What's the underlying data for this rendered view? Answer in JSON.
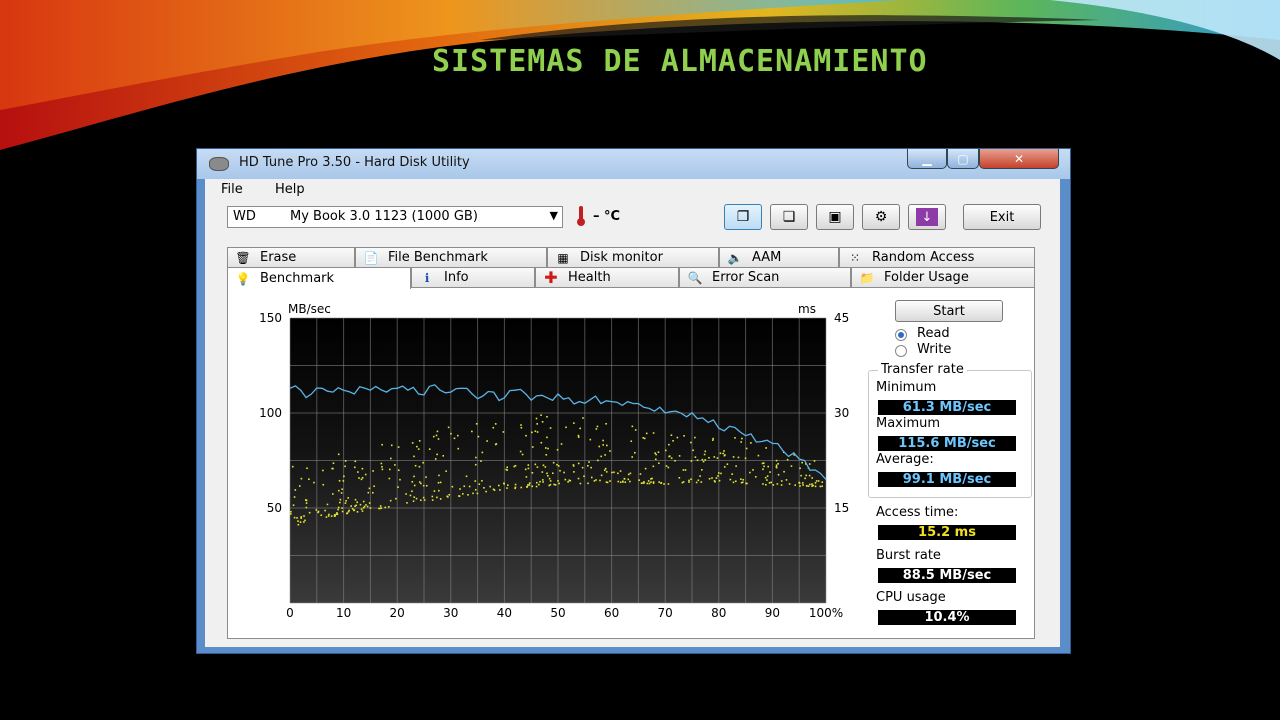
{
  "slide": {
    "title": "SISTEMAS DE ALMACENAMIENTO",
    "title_color": "#8fd14f"
  },
  "window": {
    "title": "HD Tune Pro 3.50 - Hard Disk Utility",
    "icon": "hard-disk-icon"
  },
  "menu": {
    "file": "File",
    "help": "Help"
  },
  "toolbar": {
    "drive_brand": "WD",
    "drive_model": "My Book 3.0 1123 (1000 GB)",
    "temperature": "– °C",
    "exit_label": "Exit",
    "icons": [
      "copy-text-icon",
      "copy-screenshot-icon",
      "save-icon",
      "options-icon",
      "download-icon"
    ]
  },
  "tabs": {
    "row1": [
      {
        "label": "Erase",
        "icon": "trash-icon"
      },
      {
        "label": "File Benchmark",
        "icon": "file-benchmark-icon"
      },
      {
        "label": "Disk monitor",
        "icon": "disk-monitor-icon"
      },
      {
        "label": "AAM",
        "icon": "speaker-icon"
      },
      {
        "label": "Random Access",
        "icon": "random-access-icon"
      }
    ],
    "row2": [
      {
        "label": "Benchmark",
        "icon": "lightbulb-icon",
        "selected": true
      },
      {
        "label": "Info",
        "icon": "info-icon"
      },
      {
        "label": "Health",
        "icon": "health-cross-icon"
      },
      {
        "label": "Error Scan",
        "icon": "magnifier-icon"
      },
      {
        "label": "Folder Usage",
        "icon": "folder-icon"
      }
    ]
  },
  "controls": {
    "start_label": "Start",
    "read_label": "Read",
    "write_label": "Write",
    "mode_selected": "Read"
  },
  "transfer_rate": {
    "title": "Transfer rate",
    "minimum_label": "Minimum",
    "minimum_value": "61.3 MB/sec",
    "maximum_label": "Maximum",
    "maximum_value": "115.6 MB/sec",
    "average_label": "Average:",
    "average_value": "99.1 MB/sec"
  },
  "stats": {
    "access_time_label": "Access time:",
    "access_time_value": "15.2 ms",
    "burst_rate_label": "Burst rate",
    "burst_rate_value": "88.5 MB/sec",
    "cpu_usage_label": "CPU usage",
    "cpu_usage_value": "10.4%"
  },
  "chart_data": {
    "type": "line",
    "left_unit": "MB/sec",
    "right_unit": "ms",
    "x_ticks": [
      "0",
      "10",
      "20",
      "30",
      "40",
      "50",
      "60",
      "70",
      "80",
      "90",
      "100%"
    ],
    "y_left_ticks": [
      "150",
      "100",
      "50"
    ],
    "y_right_ticks": [
      "45",
      "30",
      "15"
    ],
    "y_left_range": [
      0,
      150
    ],
    "y_right_range": [
      0,
      45
    ],
    "x_range": [
      0,
      100
    ],
    "grid": true,
    "transfer_color": "#5ab4e6",
    "access_color": "#e6e632",
    "transfer": {
      "x": [
        0,
        2,
        4,
        6,
        8,
        10,
        12,
        14,
        16,
        18,
        20,
        22,
        24,
        26,
        28,
        30,
        32,
        34,
        36,
        38,
        40,
        42,
        44,
        46,
        48,
        50,
        52,
        54,
        56,
        58,
        60,
        62,
        64,
        66,
        68,
        70,
        72,
        74,
        76,
        78,
        80,
        82,
        84,
        86,
        88,
        90,
        92,
        94,
        96,
        98,
        100
      ],
      "y": [
        113,
        112,
        110,
        113,
        111,
        112,
        110,
        113,
        114,
        111,
        113,
        112,
        110,
        114,
        112,
        111,
        113,
        110,
        109,
        111,
        108,
        112,
        110,
        109,
        108,
        110,
        108,
        106,
        107,
        105,
        106,
        104,
        105,
        103,
        101,
        100,
        101,
        98,
        97,
        95,
        92,
        93,
        90,
        89,
        85,
        84,
        80,
        79,
        75,
        70,
        65
      ]
    },
    "access": {
      "band_low": [
        8,
        10,
        11,
        12,
        13,
        14,
        15,
        15,
        16,
        16,
        17
      ],
      "band_high": [
        22,
        24,
        26,
        28,
        30,
        30,
        29,
        28,
        27,
        25,
        22
      ]
    }
  }
}
